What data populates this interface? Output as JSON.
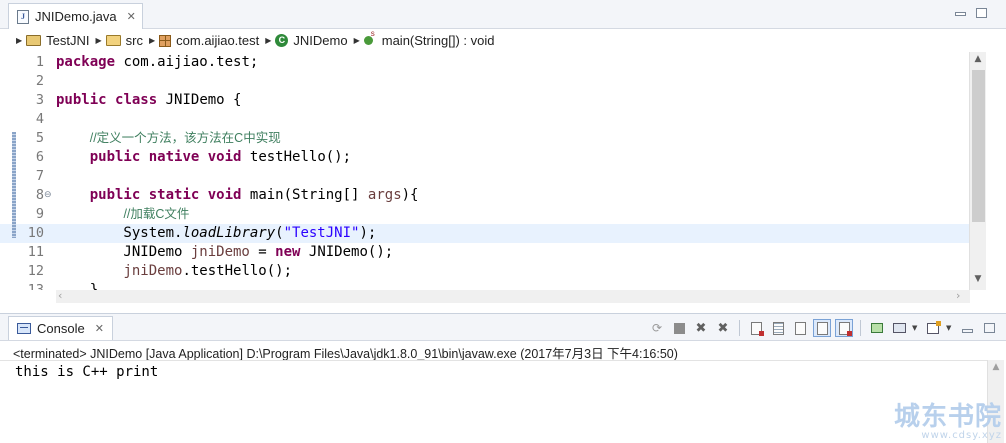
{
  "editor": {
    "tab": {
      "icon": "java-file-icon",
      "label": "JNIDemo.java"
    },
    "breadcrumb": [
      {
        "icon": "java-project-icon",
        "label": "TestJNI"
      },
      {
        "icon": "source-folder-icon",
        "label": "src"
      },
      {
        "icon": "package-icon",
        "label": "com.aijiao.test"
      },
      {
        "icon": "class-icon",
        "label": "JNIDemo"
      },
      {
        "icon": "static-method-icon",
        "label": "main(String[]) : void"
      }
    ],
    "lines": [
      {
        "num": "1",
        "tokens": [
          {
            "t": "package",
            "c": "kw"
          },
          {
            "t": " com.aijiao.test;",
            "c": ""
          }
        ]
      },
      {
        "num": "2",
        "tokens": []
      },
      {
        "num": "3",
        "tokens": [
          {
            "t": "public",
            "c": "kw"
          },
          {
            "t": " ",
            "c": ""
          },
          {
            "t": "class",
            "c": "kw"
          },
          {
            "t": " JNIDemo {",
            "c": ""
          }
        ]
      },
      {
        "num": "4",
        "tokens": []
      },
      {
        "num": "5",
        "tokens": [
          {
            "t": "    ",
            "c": ""
          },
          {
            "t": "//定义一个方法，该方法在C中实现",
            "c": "cm"
          }
        ]
      },
      {
        "num": "6",
        "tokens": [
          {
            "t": "    ",
            "c": ""
          },
          {
            "t": "public",
            "c": "kw"
          },
          {
            "t": " ",
            "c": ""
          },
          {
            "t": "native",
            "c": "kw"
          },
          {
            "t": " ",
            "c": ""
          },
          {
            "t": "void",
            "c": "kw"
          },
          {
            "t": " testHello();",
            "c": ""
          }
        ]
      },
      {
        "num": "7",
        "tokens": []
      },
      {
        "num": "8",
        "fold": "⊖",
        "tokens": [
          {
            "t": "    ",
            "c": ""
          },
          {
            "t": "public",
            "c": "kw"
          },
          {
            "t": " ",
            "c": ""
          },
          {
            "t": "static",
            "c": "kw"
          },
          {
            "t": " ",
            "c": ""
          },
          {
            "t": "void",
            "c": "kw"
          },
          {
            "t": " main(String[] ",
            "c": ""
          },
          {
            "t": "args",
            "c": "var"
          },
          {
            "t": "){",
            "c": ""
          }
        ]
      },
      {
        "num": "9",
        "tokens": [
          {
            "t": "        ",
            "c": ""
          },
          {
            "t": "//加载C文件",
            "c": "cm"
          }
        ]
      },
      {
        "num": "10",
        "current": true,
        "tokens": [
          {
            "t": "        System.",
            "c": ""
          },
          {
            "t": "loadLibrary",
            "c": "it"
          },
          {
            "t": "(",
            "c": ""
          },
          {
            "t": "\"TestJNI\"",
            "c": "str"
          },
          {
            "t": ");",
            "c": ""
          }
        ]
      },
      {
        "num": "11",
        "tokens": [
          {
            "t": "        JNIDemo ",
            "c": ""
          },
          {
            "t": "jniDemo",
            "c": "var"
          },
          {
            "t": " = ",
            "c": ""
          },
          {
            "t": "new",
            "c": "kw"
          },
          {
            "t": " JNIDemo();",
            "c": ""
          }
        ]
      },
      {
        "num": "12",
        "tokens": [
          {
            "t": "        ",
            "c": ""
          },
          {
            "t": "jniDemo",
            "c": "var"
          },
          {
            "t": ".testHello();",
            "c": ""
          }
        ]
      },
      {
        "num": "13",
        "tokens": [
          {
            "t": "    }",
            "c": ""
          }
        ]
      }
    ]
  },
  "console": {
    "tab": {
      "icon": "console-icon",
      "label": "Console"
    },
    "toolbar": [
      {
        "name": "relaunch-icon",
        "glyph": "⟳"
      },
      {
        "name": "terminate-icon",
        "glyph": "■"
      },
      {
        "name": "remove-launch-icon",
        "glyph": "✖"
      },
      {
        "name": "remove-all-terminated-icon",
        "glyph": "✖"
      },
      {
        "name": "clear-console-icon",
        "glyph": ""
      },
      {
        "name": "scroll-lock-icon",
        "glyph": ""
      },
      {
        "name": "word-wrap-icon",
        "glyph": ""
      },
      {
        "name": "show-on-stdout-icon",
        "glyph": ""
      },
      {
        "name": "show-on-stderr-icon",
        "glyph": ""
      },
      {
        "name": "pin-console-icon",
        "glyph": ""
      },
      {
        "name": "display-console-icon",
        "glyph": ""
      },
      {
        "name": "open-console-icon",
        "glyph": ""
      }
    ],
    "status": "<terminated> JNIDemo [Java Application] D:\\Program Files\\Java\\jdk1.8.0_91\\bin\\javaw.exe (2017年7月3日 下午4:16:50)",
    "output": "this is C++ print"
  },
  "watermark": {
    "main": "城东书院",
    "sub": "www.cdsy.xyz"
  }
}
